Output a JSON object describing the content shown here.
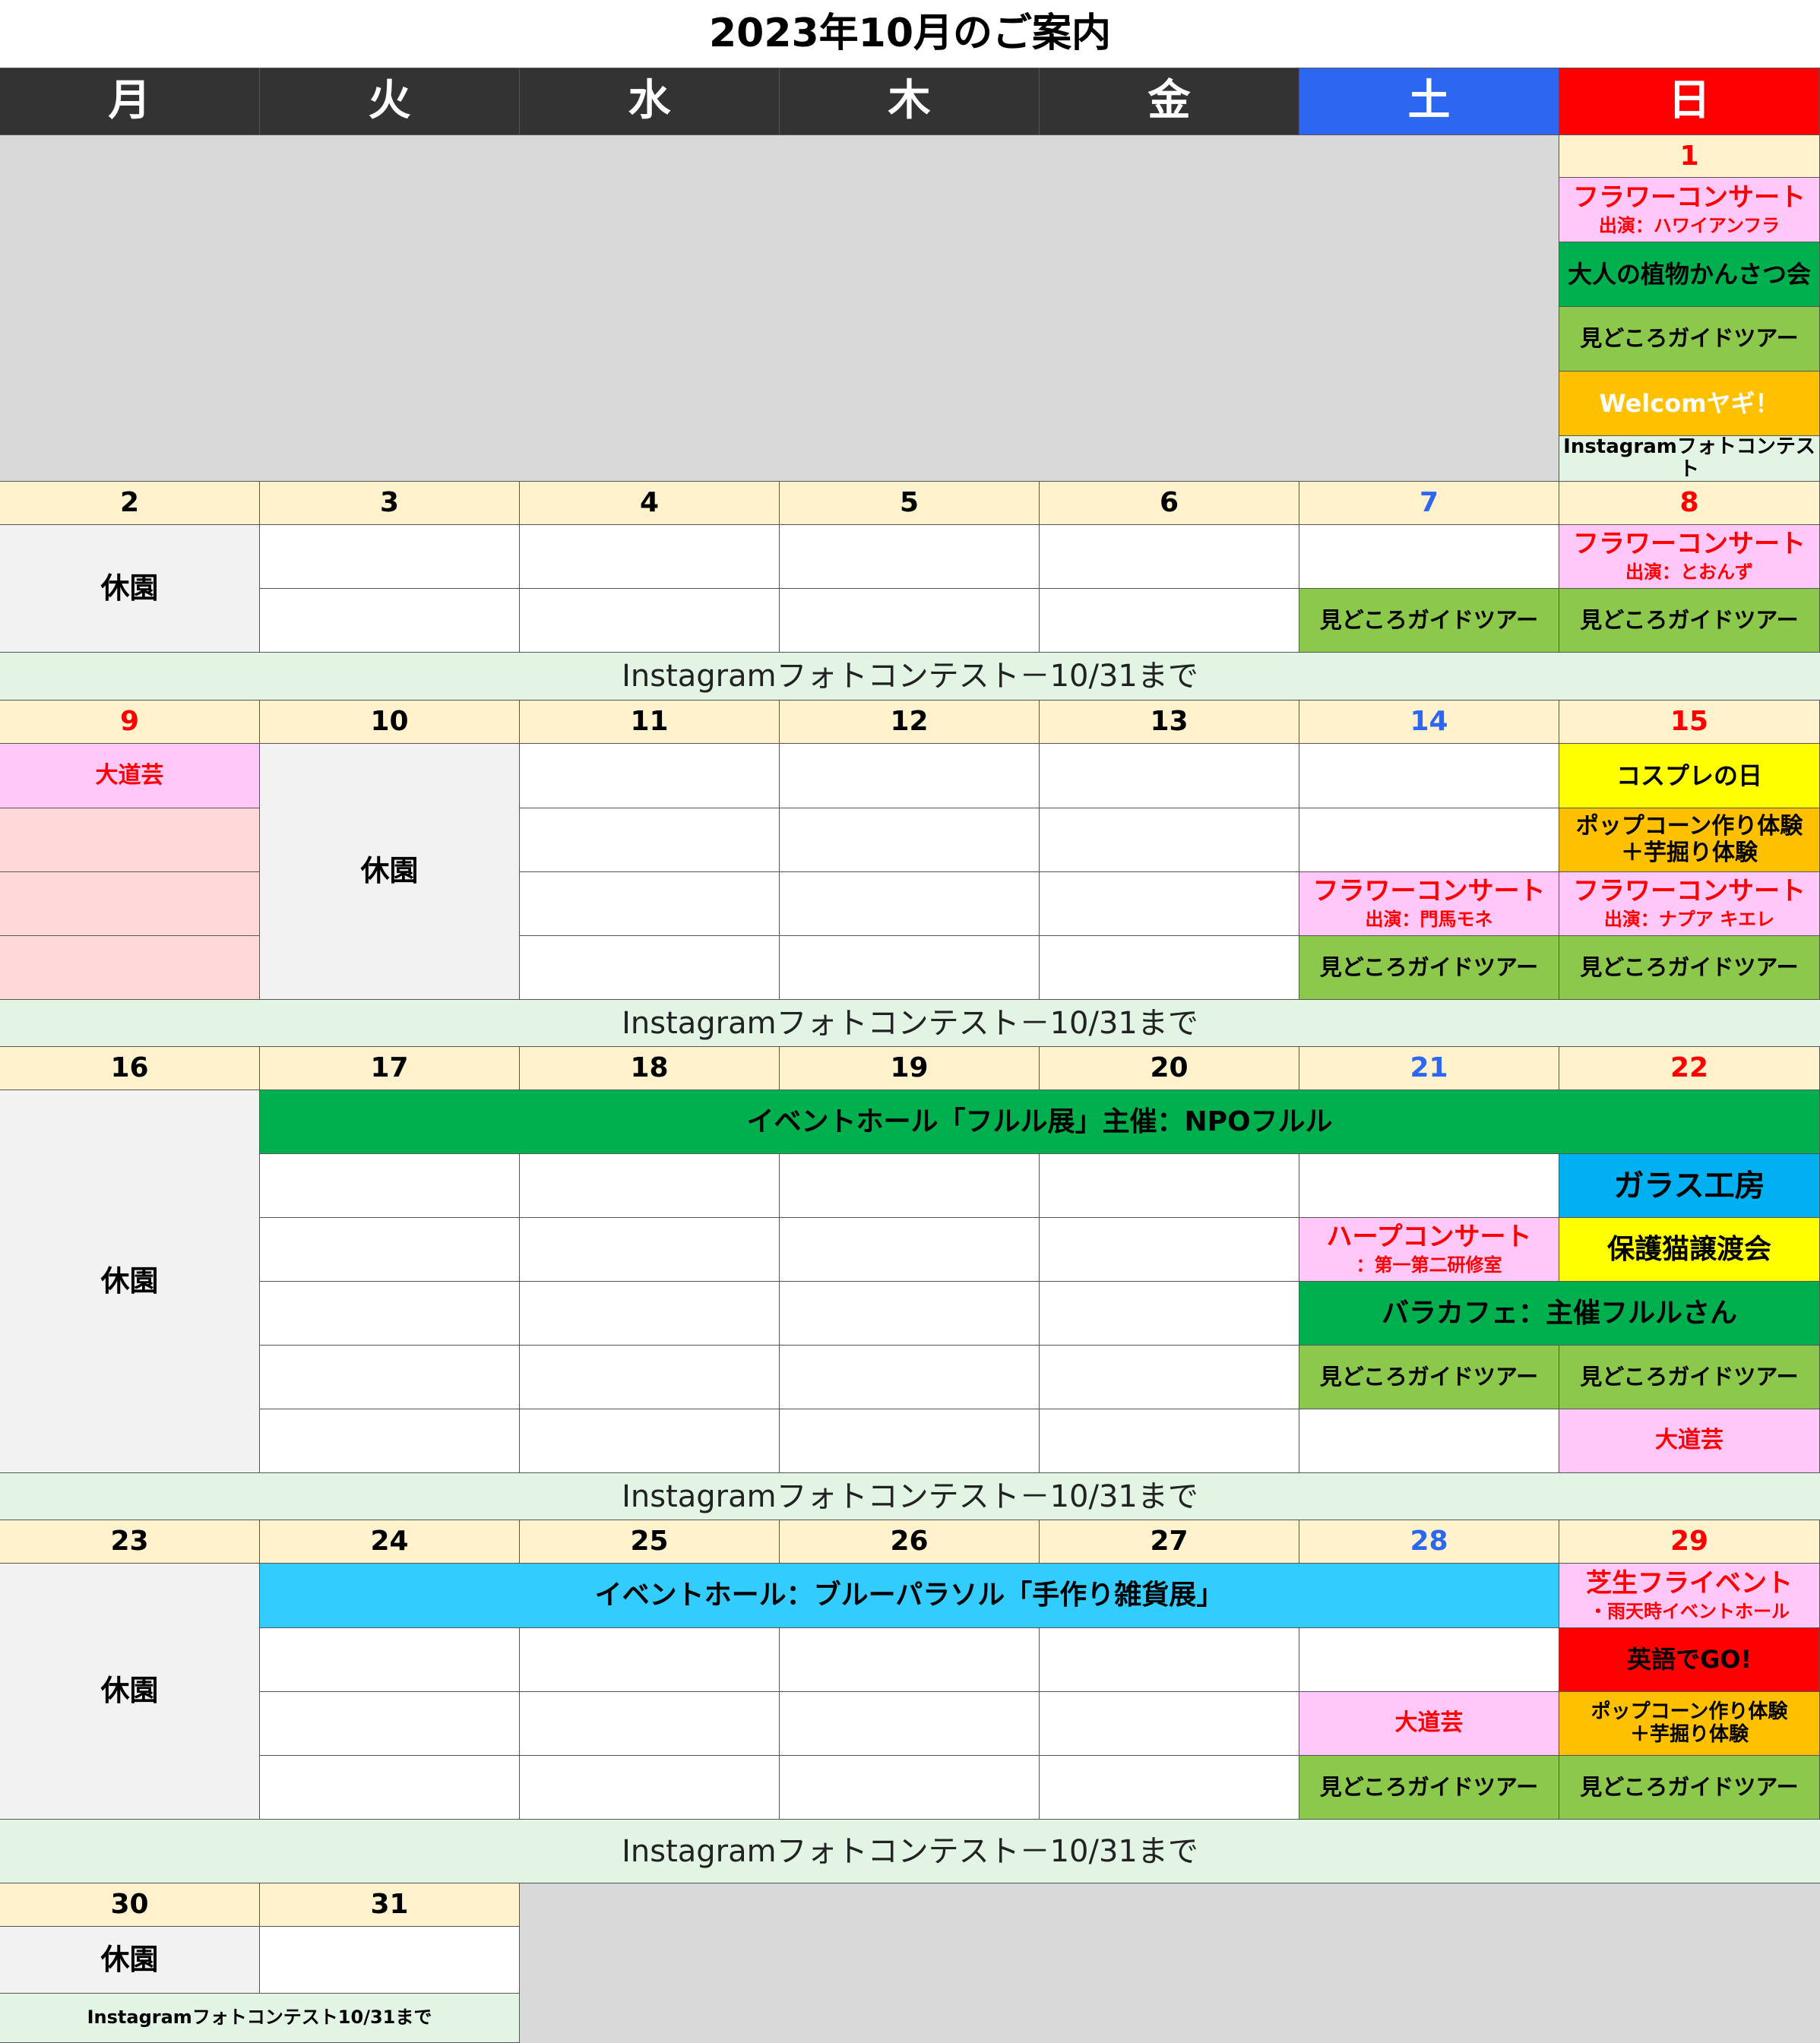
{
  "title": "2023年10月のご案内",
  "weekdays": [
    "月",
    "火",
    "水",
    "木",
    "金",
    "土",
    "日"
  ],
  "closed_label": "休園",
  "photo_contest_band": "Instagramフォトコンテスト－10/31まで",
  "photo_contest_short": "Instagramフォトコンテスト",
  "photo_contest_last": "Instagramフォトコンテスト10/31まで",
  "colors": {
    "weekday_header": "#333333",
    "saturday_header": "#2d66f0",
    "sunday_header": "#ff0000",
    "date_row": "#fff2cc",
    "band": "#e2f4e4",
    "closed": "#f2f2f2",
    "empty": "#d9d9d9"
  },
  "weeks": [
    {
      "dates": [
        "1"
      ],
      "events": {
        "flower_concert": "フラワーコンサート",
        "flower_performer": "出演：ハワイアンフラ",
        "plant_observation": "大人の植物かんさつ会",
        "guide_tour": "見どころガイドツアー",
        "welcome_goat": "Welcomヤギ！"
      }
    },
    {
      "dates": [
        "2",
        "3",
        "4",
        "5",
        "6",
        "7",
        "8"
      ],
      "events": {
        "flower_concert": "フラワーコンサート",
        "flower_performer": "出演：とおんず",
        "guide_tour_sat": "見どころガイドツアー",
        "guide_tour_sun": "見どころガイドツアー"
      }
    },
    {
      "dates": [
        "9",
        "10",
        "11",
        "12",
        "13",
        "14",
        "15"
      ],
      "events": {
        "street_performance": "大道芸",
        "cosplay": "コスプレの日",
        "popcorn_1": "ポップコーン作り体験",
        "popcorn_2": "＋芋掘り体験",
        "flower_concert_sat": "フラワーコンサート",
        "flower_performer_sat": "出演：門馬モネ",
        "flower_concert_sun": "フラワーコンサート",
        "flower_performer_sun": "出演：ナプア キエレ",
        "guide_tour_sat": "見どころガイドツアー",
        "guide_tour_sun": "見どころガイドツアー"
      }
    },
    {
      "dates": [
        "16",
        "17",
        "18",
        "19",
        "20",
        "21",
        "22"
      ],
      "events": {
        "hall_exhibition": "イベントホール「フルル展」主催：NPOフルル",
        "glass_studio": "ガラス工房",
        "harp_concert": "ハープコンサート",
        "harp_venue": "：第一第二研修室",
        "cat_adoption": "保護猫譲渡会",
        "rose_cafe": "バラカフェ：主催フルルさん",
        "guide_tour_sat": "見どころガイドツアー",
        "guide_tour_sun": "見どころガイドツアー",
        "street_performance": "大道芸"
      }
    },
    {
      "dates": [
        "23",
        "24",
        "25",
        "26",
        "27",
        "28",
        "29"
      ],
      "events": {
        "hall_exhibition": "イベントホール：ブルーパラソル「手作り雑貨展」",
        "lawn_event": "芝生フライベント",
        "lawn_event_note": "・雨天時イベントホール",
        "english_go": "英語でGO!",
        "popcorn_1": "ポップコーン作り体験",
        "popcorn_2": "＋芋掘り体験",
        "street_performance": "大道芸",
        "guide_tour_sat": "見どころガイドツアー",
        "guide_tour_sun": "見どころガイドツアー"
      }
    },
    {
      "dates": [
        "30",
        "31"
      ]
    }
  ]
}
